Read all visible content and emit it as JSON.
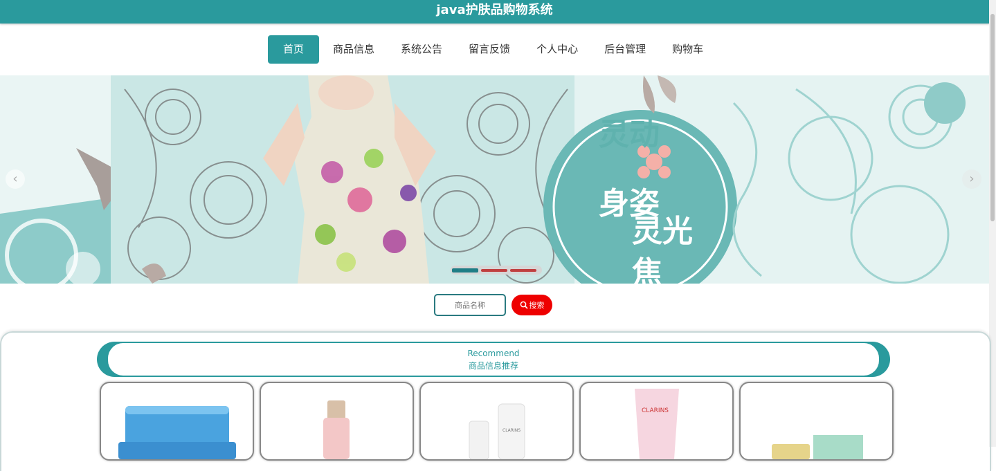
{
  "header": {
    "title": "java护肤品购物系统"
  },
  "nav": {
    "items": [
      {
        "label": "首页",
        "active": true
      },
      {
        "label": "商品信息"
      },
      {
        "label": "系统公告"
      },
      {
        "label": "留言反馈"
      },
      {
        "label": "个人中心"
      },
      {
        "label": "后台管理"
      },
      {
        "label": "购物车"
      }
    ]
  },
  "banner": {
    "slide_count": 3,
    "active_slide": 1,
    "text": [
      "灵动",
      "身姿",
      "灵光",
      "焦"
    ],
    "colors": {
      "teal": "#7cc3c1",
      "accent": "#2a9a9d"
    }
  },
  "search": {
    "placeholder": "商品名称",
    "button_label": "搜索"
  },
  "recommend": {
    "en": "Recommend",
    "cn": "商品信息推荐"
  },
  "products": [
    {
      "icon": "blue-jar-product-image"
    },
    {
      "icon": "pink-bottle-product-image"
    },
    {
      "icon": "white-bottles-product-image"
    },
    {
      "icon": "pink-tube-product-image"
    },
    {
      "icon": "green-box-product-image"
    }
  ],
  "colors": {
    "primary": "#2a9a9d",
    "search_button": "#ee0000"
  }
}
